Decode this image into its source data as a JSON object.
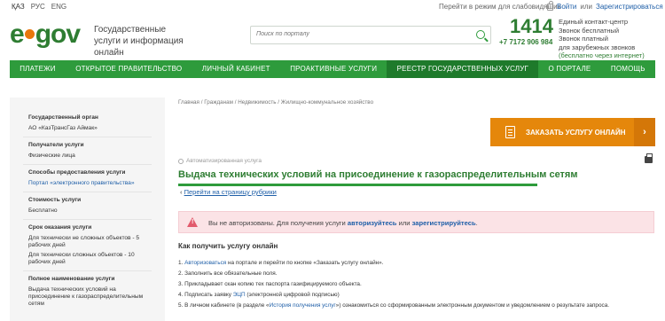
{
  "topbar": {
    "languages": [
      "ҚАЗ",
      "РУС",
      "ENG"
    ],
    "visually_impaired": "Перейти в режим для слабовидящих",
    "login": "Войти",
    "or": "или",
    "register": "Зарегистрироваться"
  },
  "header": {
    "logo_e": "e",
    "logo_gov": "gov",
    "tagline": "Государственные услуги и информация онлайн",
    "search_placeholder": "Поиск по порталу",
    "phone_short": "1414",
    "phone_long": "+7 7172 906 984",
    "contacts": [
      "Единый контакт-центр",
      "Звонок бесплатный",
      "Звонок платный",
      "для зарубежных звонков",
      "(бесплатно через интернет)"
    ]
  },
  "nav": {
    "items": [
      "ПЛАТЕЖИ",
      "ОТКРЫТОЕ ПРАВИТЕЛЬСТВО",
      "ЛИЧНЫЙ КАБИНЕТ",
      "ПРОАКТИВНЫЕ УСЛУГИ",
      "РЕЕСТР ГОСУДАРСТВЕННЫХ УСЛУГ",
      "О ПОРТАЛЕ",
      "ПОМОЩЬ"
    ]
  },
  "sidebar": {
    "gov_body_title": "Государственный орган",
    "gov_body_value": "АО «КазТрансГаз Аймак»",
    "recipients_title": "Получатели услуги",
    "recipients_value": "Физические лица",
    "methods_title": "Способы предоставления услуги",
    "methods_value": "Портал «электронного правительства»",
    "cost_title": "Стоимость услуги",
    "cost_value": "Бесплатно",
    "terms_title": "Срок оказания услуги",
    "terms_value_1": "Для технически не сложных объектов - 5 рабочих дней",
    "terms_value_2": "Для технически сложных объектов - 10 рабочих дней",
    "fullname_title": "Полное наименование услуги",
    "fullname_value": "Выдача технических условий на присоединение к газораспределительным сетям"
  },
  "main": {
    "breadcrumbs": "Главная / Гражданам / Недвижимость / Жилищно-коммунальное хозяйство",
    "order_button": "ЗАКАЗАТЬ УСЛУГУ ОНЛАЙН",
    "order_arrow": "›",
    "automated": "Автоматизированная услуга",
    "title": "Выдача технических условий на присоединение к газораспределительным сетям",
    "back_arrow": "‹",
    "rubric_link": "Перейти на страницу рубрики",
    "alert_text_1": "Вы не авторизованы. Для получения услуги ",
    "alert_login": "авторизуйтесь",
    "alert_or": " или ",
    "alert_register": "зарегистрируйтесь",
    "alert_end": ".",
    "howto_title": "Как получить услугу онлайн",
    "step1_num": "1. ",
    "step1_link": "Авторизоваться",
    "step1_rest": " на портале и перейти по кнопке «Заказать услугу онлайн».",
    "step2": "2. Заполнить все обязательные поля.",
    "step3": "3. Прикладывает скан копию тех паспорта газифицируемого объекта.",
    "step4_a": "4. Подписать заявку ",
    "step4_link": "ЭЦП",
    "step4_b": " (электронной цифровой подписью)",
    "step5_a": "5. В личном кабинете (в разделе «",
    "step5_link": "История получения услуг",
    "step5_b": "») ознакомиться со сформированным электронным документом и уведомлением о результате запроса."
  },
  "colors": {
    "brand_green": "#2e9b3c",
    "dark_green": "#2e7d32",
    "orange": "#e5870b",
    "alert_bg": "#fbe3e6"
  }
}
